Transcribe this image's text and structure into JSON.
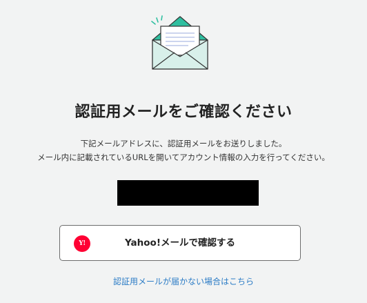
{
  "icons": {
    "envelope": "open-envelope-with-letter",
    "yahoo_logo_text": "Y!"
  },
  "colors": {
    "background": "#f2f3f3",
    "envelope_teal": "#2fbfa0",
    "envelope_fill": "#d8f0ea",
    "yahoo_red": "#ff0033",
    "link": "#2c7cc6"
  },
  "page": {
    "title": "認証用メールをご確認ください",
    "description_line1": "下記メールアドレスに、認証用メールをお送りしました。",
    "description_line2": "メール内に記載されているURLを開いてアカウント情報の入力を行ってください。",
    "yahoo_button_label": "Yahoo!メールで確認する",
    "help_link": "認証用メールが届かない場合はこちら"
  }
}
